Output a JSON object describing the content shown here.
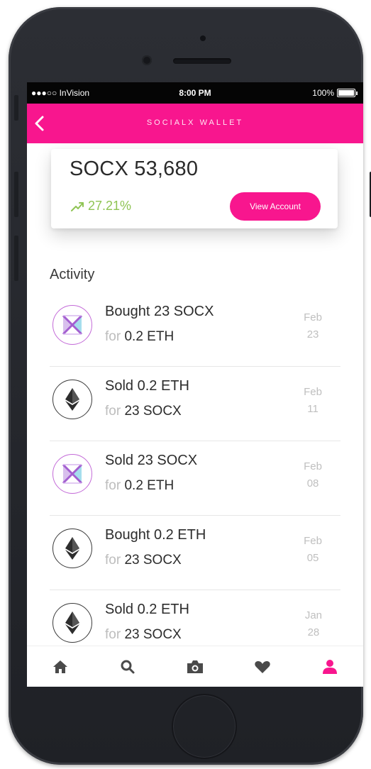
{
  "status_bar": {
    "carrier": "●●●○○ InVision",
    "time": "8:00 PM",
    "battery": "100%"
  },
  "header": {
    "title": "SOCIALX WALLET",
    "back_icon": "chevron-left-icon",
    "color": "#f8168e"
  },
  "balance_card": {
    "balance": "SOCX 53,680",
    "change": "27.21%",
    "change_color": "#8fc454",
    "view_account_label": "View Account"
  },
  "activity": {
    "title": "Activity",
    "items": [
      {
        "icon": "socx-logo-icon",
        "title": "Bought 23 SOCX",
        "for_label": "for",
        "for_value": "0.2 ETH",
        "month": "Feb",
        "day": "23"
      },
      {
        "icon": "ethereum-icon",
        "title": "Sold 0.2 ETH",
        "for_label": "for",
        "for_value": "23 SOCX",
        "month": "Feb",
        "day": "11"
      },
      {
        "icon": "socx-logo-icon",
        "title": "Sold 23 SOCX",
        "for_label": "for",
        "for_value": "0.2 ETH",
        "month": "Feb",
        "day": "08"
      },
      {
        "icon": "ethereum-icon",
        "title": "Bought 0.2 ETH",
        "for_label": "for",
        "for_value": "23 SOCX",
        "month": "Feb",
        "day": "05"
      },
      {
        "icon": "ethereum-icon",
        "title": "Sold 0.2 ETH",
        "for_label": "for",
        "for_value": "23 SOCX",
        "month": "Jan",
        "day": "28"
      }
    ]
  },
  "tab_bar": {
    "tabs": [
      {
        "icon": "home-icon",
        "active": false
      },
      {
        "icon": "search-icon",
        "active": false
      },
      {
        "icon": "camera-icon",
        "active": false
      },
      {
        "icon": "heart-icon",
        "active": false
      },
      {
        "icon": "profile-icon",
        "active": true
      }
    ],
    "active_color": "#f8168e",
    "inactive_color": "#4a4a4a"
  }
}
